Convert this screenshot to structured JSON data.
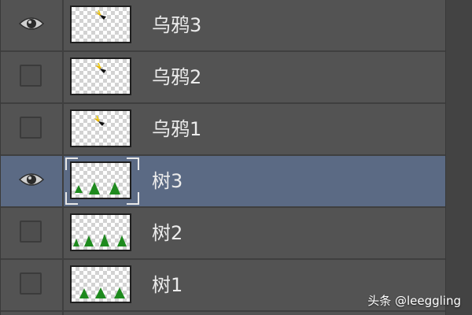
{
  "layers_panel": {
    "layers": [
      {
        "name": "乌鸦3",
        "visible": true,
        "selected": false,
        "thumb": "crow"
      },
      {
        "name": "乌鸦2",
        "visible": false,
        "selected": false,
        "thumb": "crow"
      },
      {
        "name": "乌鸦1",
        "visible": false,
        "selected": false,
        "thumb": "crow"
      },
      {
        "name": "树3",
        "visible": true,
        "selected": true,
        "thumb": "trees3"
      },
      {
        "name": "树2",
        "visible": false,
        "selected": false,
        "thumb": "trees2"
      },
      {
        "name": "树1",
        "visible": false,
        "selected": false,
        "thumb": "trees1"
      }
    ]
  },
  "watermark": "头条 @leeggling",
  "colors": {
    "panel_bg": "#535353",
    "selected_row": "#5b6a84",
    "text": "#ececec",
    "tree_green": "#1e8a1e"
  }
}
